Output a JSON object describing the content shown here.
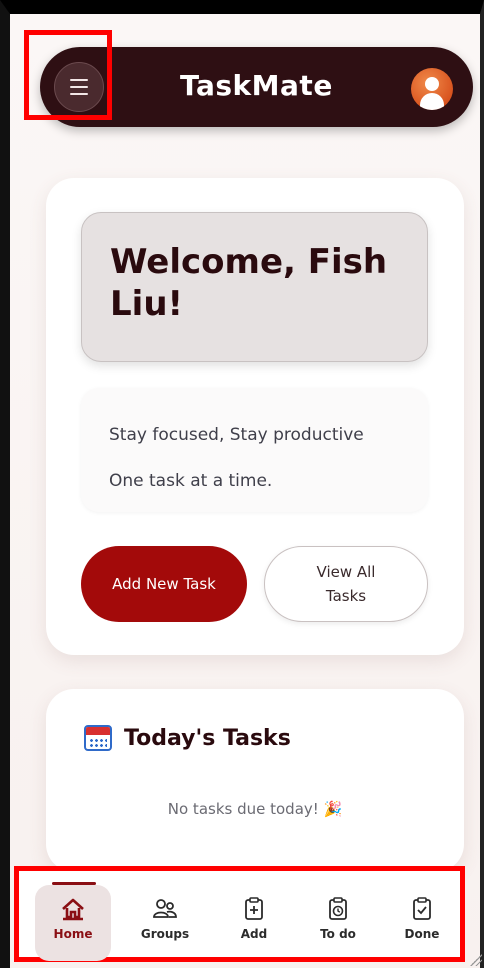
{
  "header": {
    "title": "TaskMate",
    "menu_icon": "hamburger-menu-icon",
    "avatar_icon": "user-avatar-icon"
  },
  "welcome": {
    "heading": "Welcome, Fish Liu!",
    "line1": "Stay focused, Stay productive",
    "line2": "One task at a time.",
    "primary_button": "Add New Task",
    "secondary_button": "View All Tasks"
  },
  "today": {
    "icon": "calendar-icon",
    "title": "Today's Tasks",
    "empty_message": "No tasks due today! 🎉"
  },
  "nav": {
    "items": [
      {
        "label": "Home",
        "icon": "home-icon",
        "active": true
      },
      {
        "label": "Groups",
        "icon": "groups-icon",
        "active": false
      },
      {
        "label": "Add",
        "icon": "add-clipboard-icon",
        "active": false
      },
      {
        "label": "To do",
        "icon": "todo-clipboard-icon",
        "active": false
      },
      {
        "label": "Done",
        "icon": "done-clipboard-icon",
        "active": false
      }
    ]
  },
  "colors": {
    "header_bg": "#2e0f13",
    "primary": "#a30a0a",
    "active_nav": "#8a0f14",
    "highlight": "#ff0000"
  }
}
